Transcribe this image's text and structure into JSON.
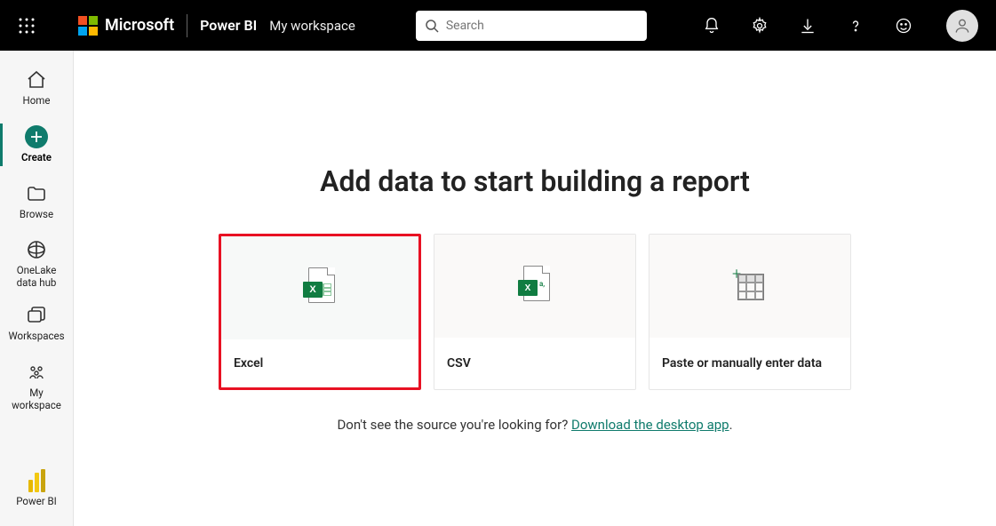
{
  "header": {
    "brand": "Microsoft",
    "product": "Power BI",
    "workspace": "My workspace",
    "search_placeholder": "Search"
  },
  "sidebar": {
    "items": [
      {
        "id": "home",
        "label": "Home"
      },
      {
        "id": "create",
        "label": "Create"
      },
      {
        "id": "browse",
        "label": "Browse"
      },
      {
        "id": "onelake",
        "label": "OneLake\ndata hub"
      },
      {
        "id": "workspaces",
        "label": "Workspaces"
      },
      {
        "id": "myworkspace",
        "label": "My\nworkspace"
      }
    ],
    "footer": {
      "label": "Power BI"
    }
  },
  "main": {
    "title": "Add data to start building a report",
    "cards": [
      {
        "id": "excel",
        "label": "Excel",
        "highlighted": true
      },
      {
        "id": "csv",
        "label": "CSV",
        "highlighted": false
      },
      {
        "id": "paste",
        "label": "Paste or manually enter data",
        "highlighted": false
      }
    ],
    "hint_prefix": "Don't see the source you're looking for? ",
    "hint_link": "Download the desktop app",
    "hint_suffix": "."
  }
}
